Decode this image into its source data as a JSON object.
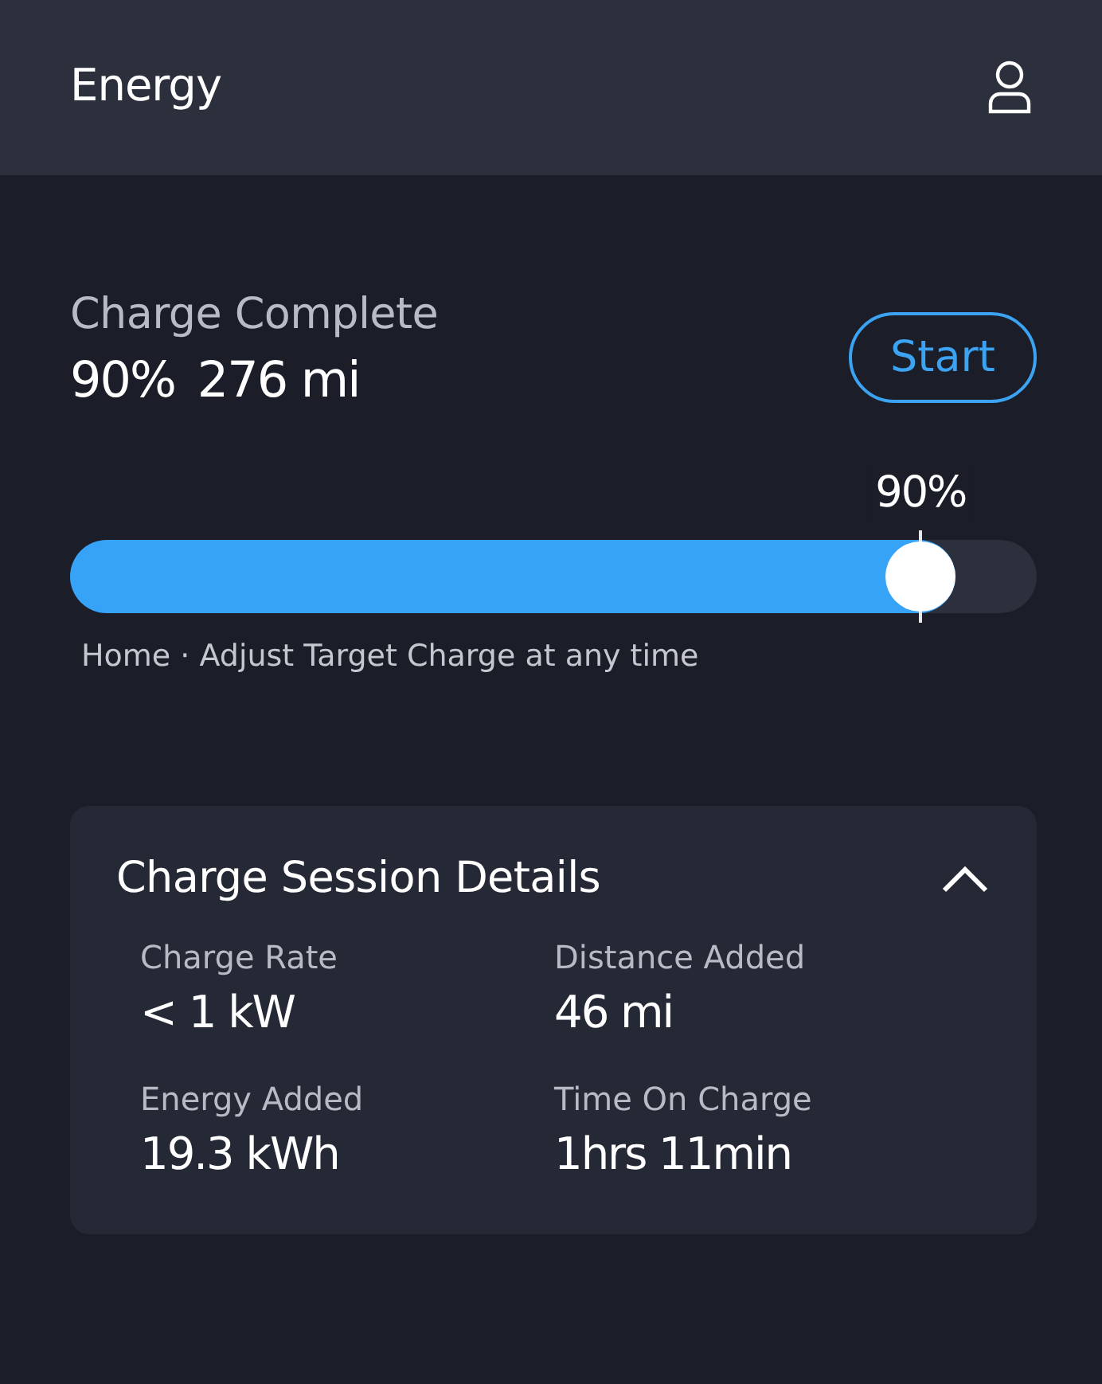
{
  "header": {
    "title": "Energy"
  },
  "status": {
    "label": "Charge Complete",
    "percent": "90%",
    "range": "276 mi"
  },
  "start_button": {
    "label": "Start"
  },
  "target_charge": {
    "level": 0.88,
    "reading": "90%",
    "note": "Home · Adjust Target Charge at any time"
  },
  "session_details": {
    "title": "Charge Session Details",
    "expanded": true,
    "items": [
      {
        "label": "Charge Rate",
        "value": "< 1 kW"
      },
      {
        "label": "Distance Added",
        "value": "46 mi"
      },
      {
        "label": "Energy Added",
        "value": "19.3 kWh"
      },
      {
        "label": "Time On Charge",
        "value": "1hrs 11min"
      }
    ]
  }
}
